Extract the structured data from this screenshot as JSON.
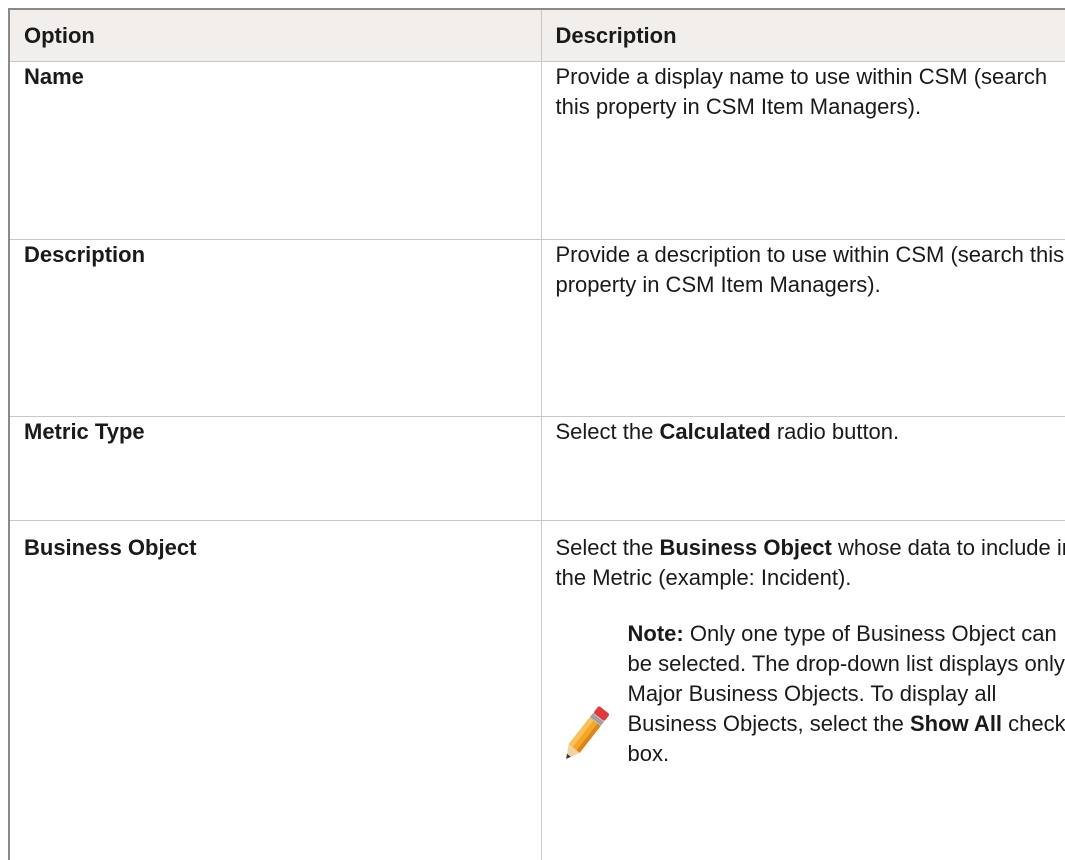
{
  "table": {
    "headers": {
      "option": "Option",
      "description": "Description"
    },
    "rows": [
      {
        "option": "Name",
        "description": "Provide a display name to use within CSM (search this property in CSM Item Managers)."
      },
      {
        "option": "Description",
        "description": "Provide a description to use within CSM (search this property in CSM Item Managers)."
      },
      {
        "option": "Metric Type",
        "description_pre": "Select the ",
        "description_bold": "Calculated",
        "description_post": " radio button."
      },
      {
        "option": "Business Object",
        "description_pre": "Select the ",
        "description_bold": "Business Object",
        "description_post": " whose data to include in the Metric (example: Incident).",
        "note": {
          "icon": "pencil-icon",
          "label": "Note:",
          "text_1": " Only one type of Business Object can be selected. The drop-down list displays only Major Business Objects. To display all Business Objects, select the ",
          "bold_1": "Show All",
          "text_2": " check box."
        }
      }
    ]
  }
}
